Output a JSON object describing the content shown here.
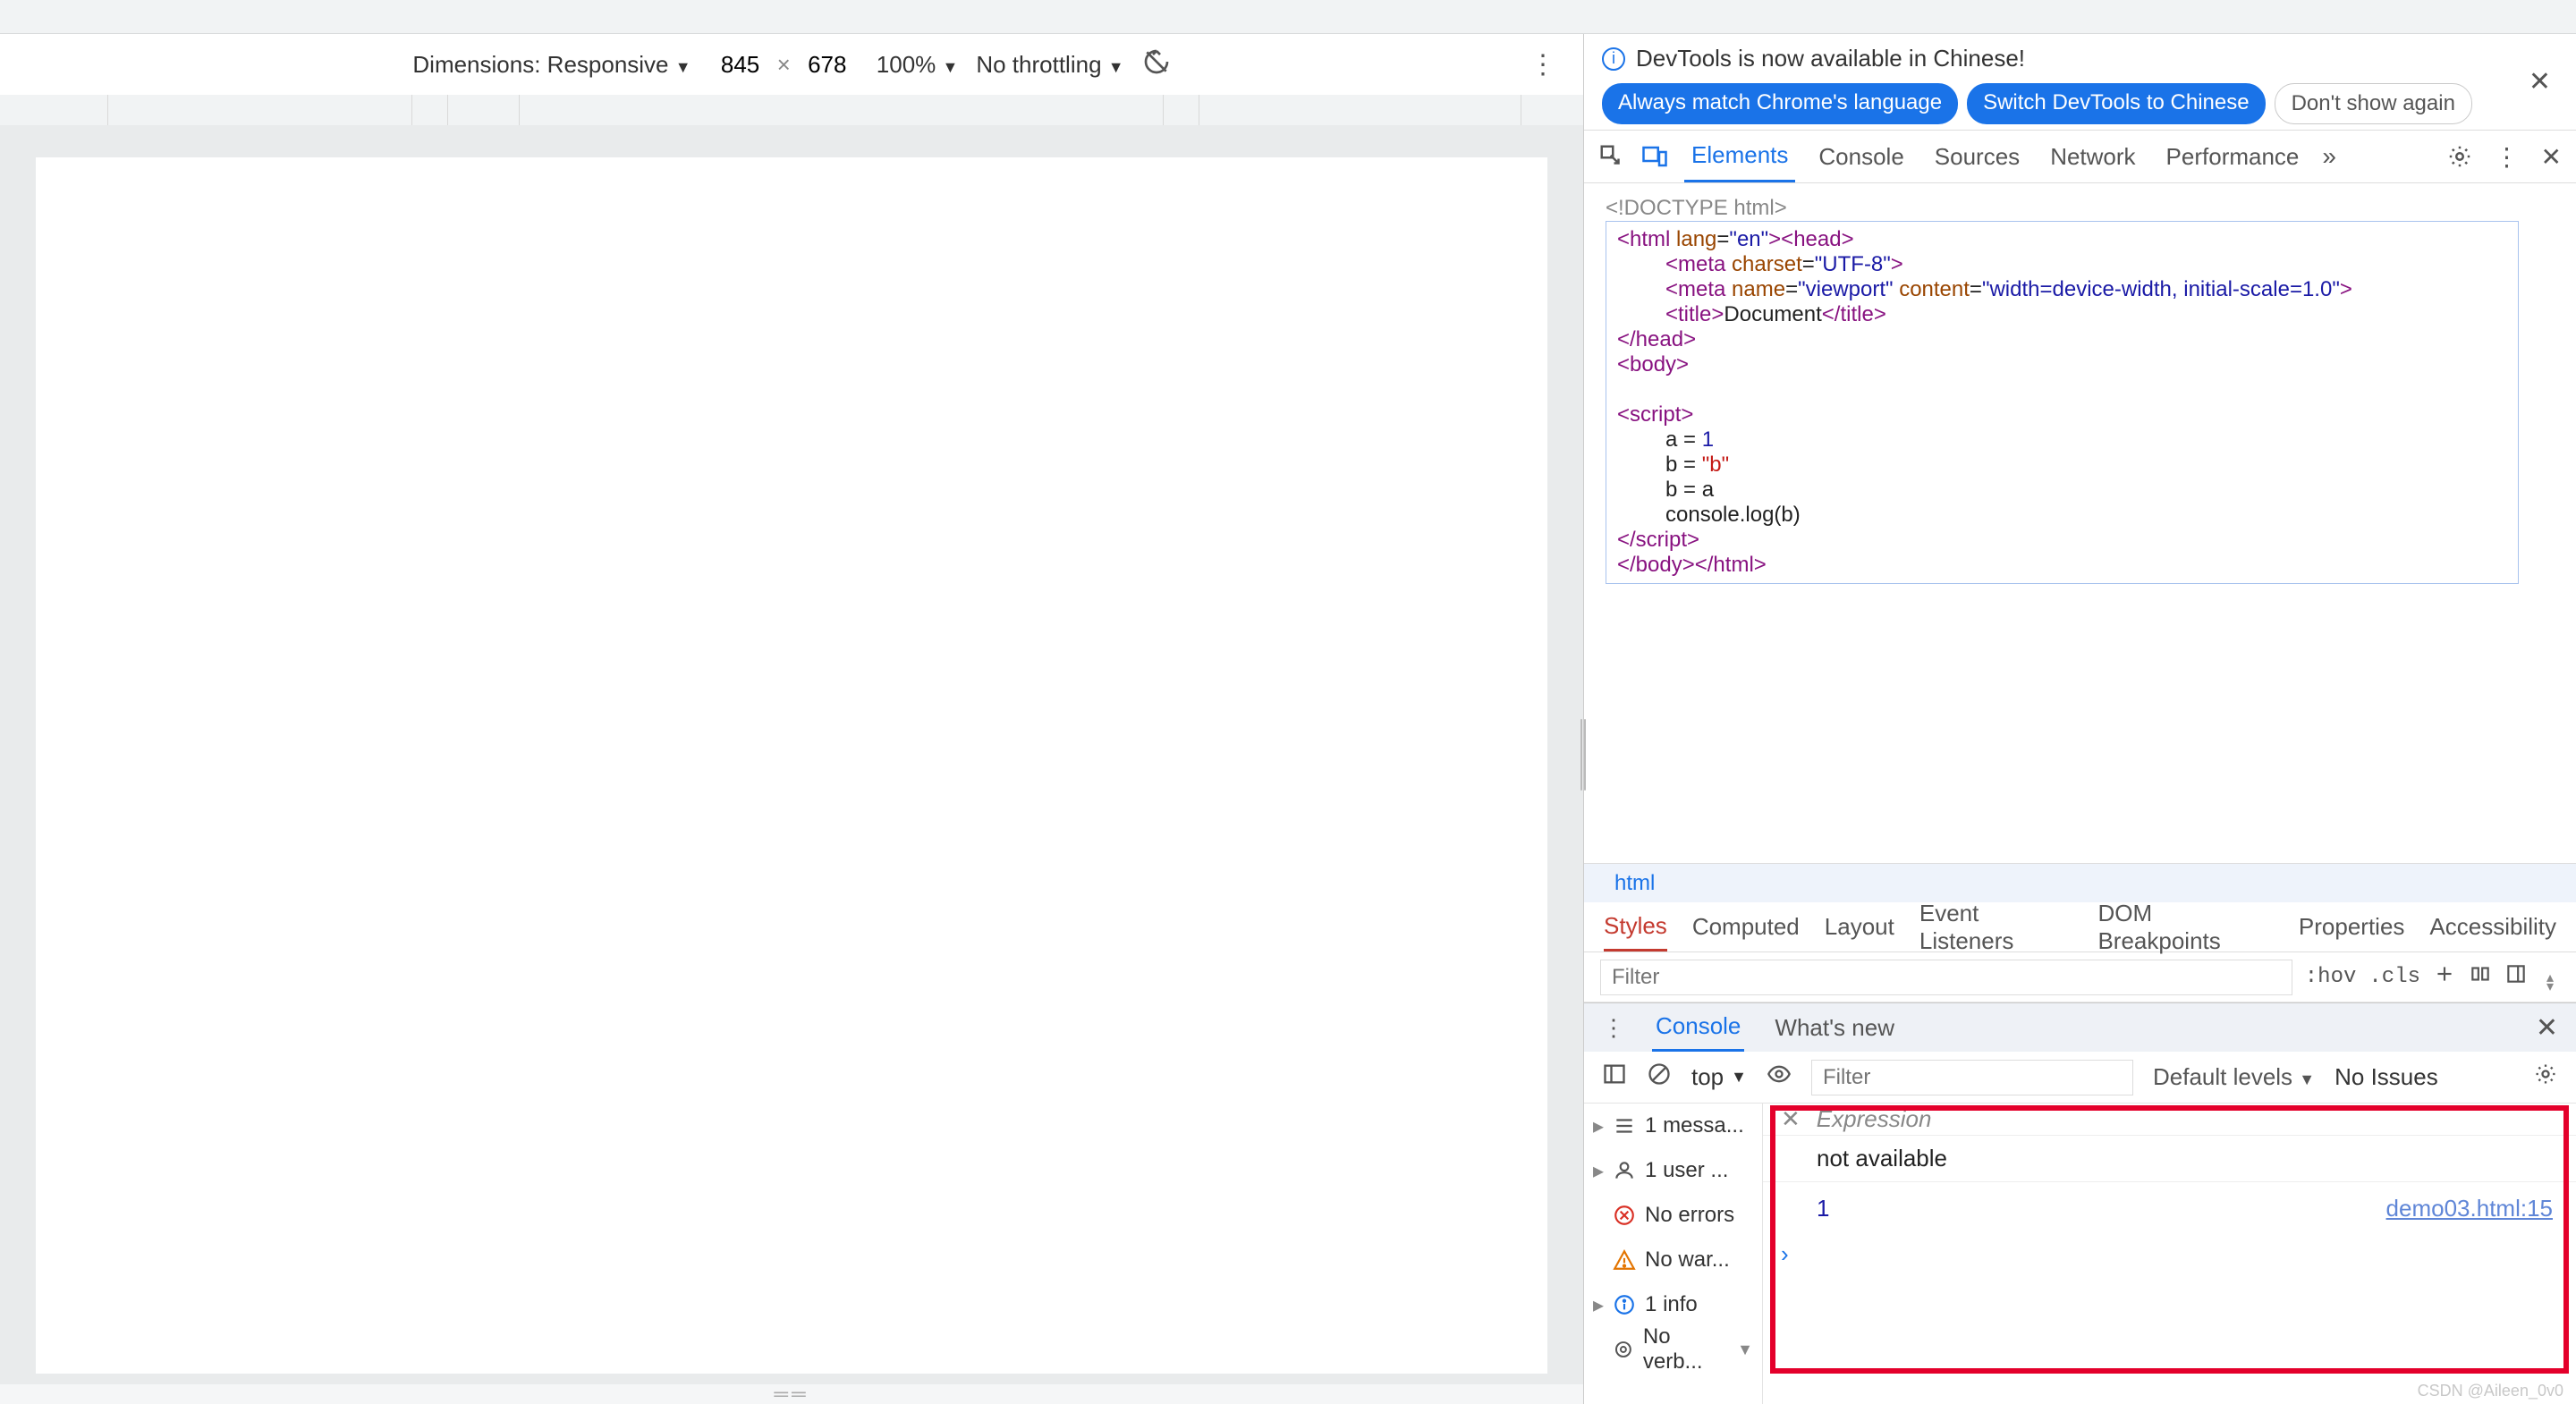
{
  "deviceToolbar": {
    "dimensionsLabel": "Dimensions: Responsive",
    "width": "845",
    "height": "678",
    "zoom": "100%",
    "throttling": "No throttling"
  },
  "langBanner": {
    "message": "DevTools is now available in Chinese!",
    "btnAlways": "Always match Chrome's language",
    "btnSwitch": "Switch DevTools to Chinese",
    "btnDismiss": "Don't show again"
  },
  "mainTabs": {
    "elements": "Elements",
    "console": "Console",
    "sources": "Sources",
    "network": "Network",
    "performance": "Performance"
  },
  "dom": {
    "doctype": "<!DOCTYPE html>",
    "titleText": "Document",
    "scriptLines": {
      "a1": "a = ",
      "a1v": "1",
      "b1": "b = ",
      "b1v": "\"b\"",
      "b2": "b = a",
      "log": "console.log(b)"
    }
  },
  "breadcrumb": {
    "html": "html"
  },
  "stylesTabs": {
    "styles": "Styles",
    "computed": "Computed",
    "layout": "Layout",
    "listeners": "Event Listeners",
    "dombp": "DOM Breakpoints",
    "properties": "Properties",
    "accessibility": "Accessibility"
  },
  "stylesFilter": {
    "placeholder": "Filter",
    "hov": ":hov",
    "cls": ".cls"
  },
  "drawer": {
    "console": "Console",
    "whatsNew": "What's new"
  },
  "consoleToolbar": {
    "context": "top",
    "filterPlaceholder": "Filter",
    "levels": "Default levels",
    "issues": "No Issues"
  },
  "consoleSidebar": {
    "messages": "1 messa...",
    "user": "1 user ...",
    "errors": "No errors",
    "warnings": "No war...",
    "info": "1 info",
    "verbose": "No verb..."
  },
  "consoleOut": {
    "exprPlaceholder": "Expression",
    "notAvailable": "not available",
    "value": "1",
    "source": "demo03.html:15",
    "prompt": "›"
  },
  "watermark": "CSDN @Aileen_0v0"
}
